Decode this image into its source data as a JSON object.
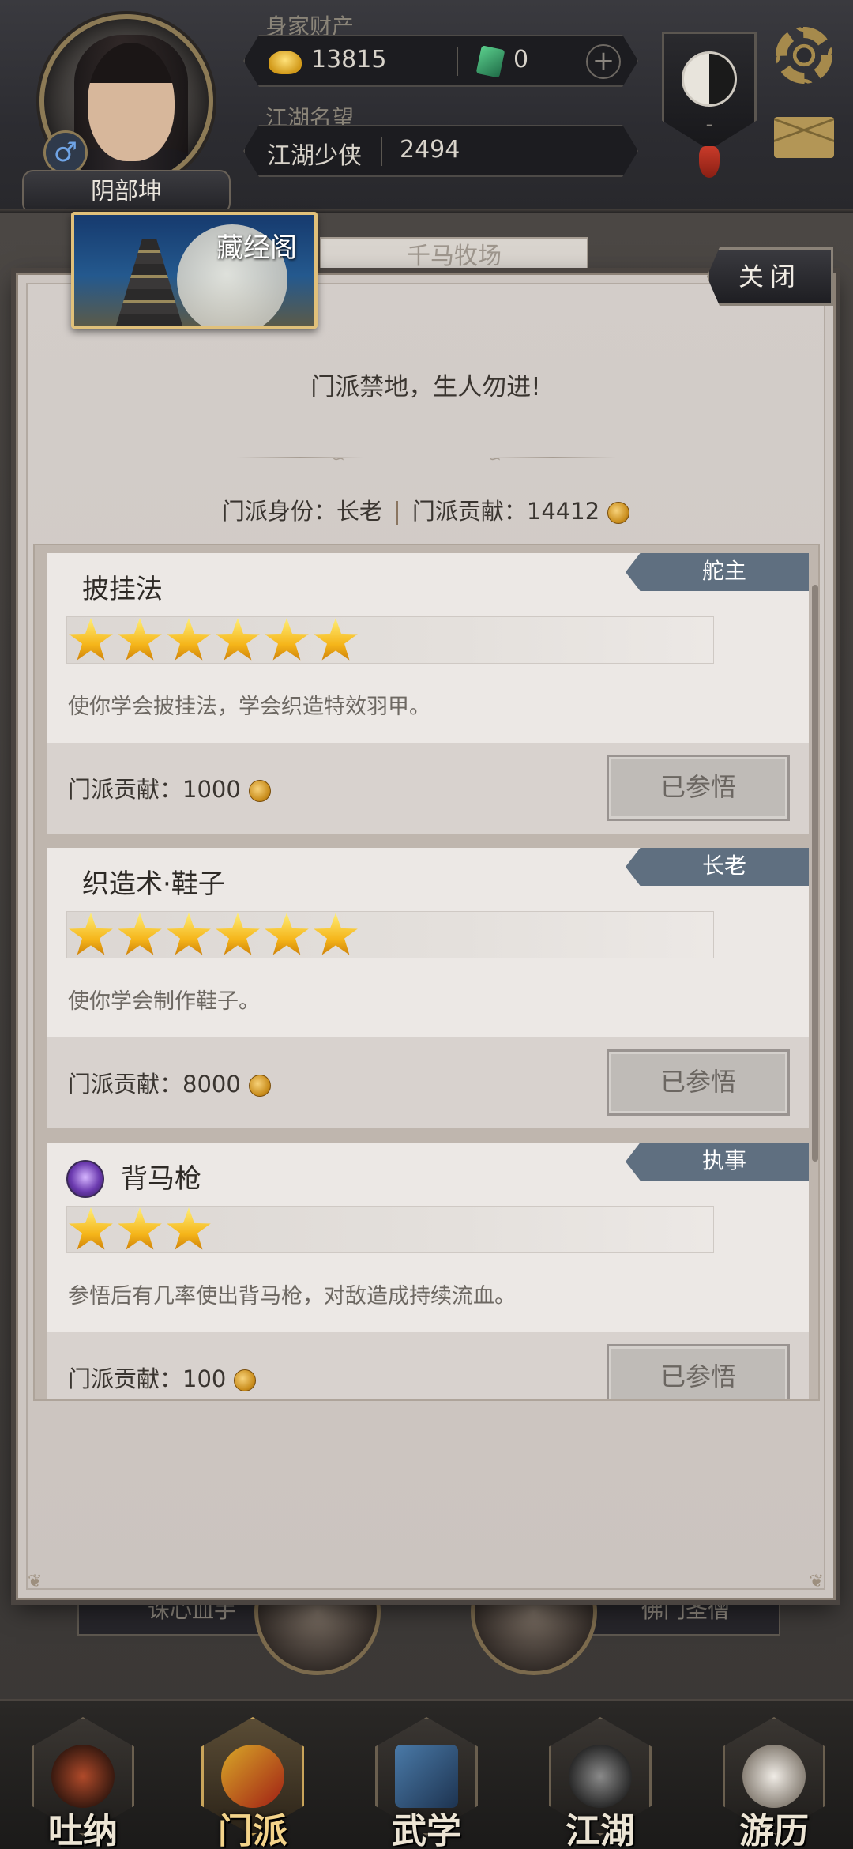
{
  "hud": {
    "wealth_label": "身家财产",
    "gold_amount": "13815",
    "jade_amount": "0",
    "add_symbol": "+",
    "reputation_label": "江湖名望",
    "reputation_title": "江湖少侠",
    "reputation_value": "2494",
    "player_name": "阴部坤",
    "gender_symbol": "♂",
    "taiji_value": "-"
  },
  "background": {
    "tab_hint": "千马牧场",
    "left_chip": "诛心血手",
    "right_chip": "佛门圣僧"
  },
  "modal": {
    "title": "藏经阁",
    "close_label": "关闭",
    "motto": "门派禁地，生人勿进!",
    "identity_label": "门派身份：",
    "identity_value": "长老",
    "contribution_label": "门派贡献：",
    "contribution_value": "14412",
    "skills": [
      {
        "name": "披挂法",
        "rank": "舵主",
        "stars": 6,
        "description": "使你学会披挂法，学会织造特效羽甲。",
        "cost_label": "门派贡献：",
        "cost": "1000",
        "button": "已参悟",
        "icon": ""
      },
      {
        "name": "织造术·鞋子",
        "rank": "长老",
        "stars": 6,
        "description": "使你学会制作鞋子。",
        "cost_label": "门派贡献：",
        "cost": "8000",
        "button": "已参悟",
        "icon": ""
      },
      {
        "name": "背马枪",
        "rank": "执事",
        "stars": 3,
        "description": "参悟后有几率使出背马枪，对敌造成持续流血。",
        "cost_label": "门派贡献：",
        "cost": "100",
        "button": "已参悟",
        "icon": "spear-skill-icon"
      }
    ]
  },
  "nav": {
    "items": [
      {
        "label": "吐纳",
        "active": false
      },
      {
        "label": "门派",
        "active": true
      },
      {
        "label": "武学",
        "active": false
      },
      {
        "label": "江湖",
        "active": false
      },
      {
        "label": "游历",
        "active": false
      }
    ]
  },
  "colors": {
    "rank_tag": "#5f6f80",
    "modal_bg": "#cdc6c1",
    "card_bg": "#ece8e5",
    "gold_frame": "#e0c07a"
  }
}
